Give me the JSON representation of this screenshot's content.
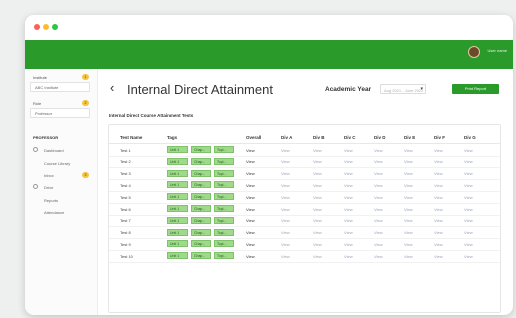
{
  "topbar": {
    "username": "User name"
  },
  "sidebar": {
    "institute_label": "Institute",
    "institute_value": "ABC Institute",
    "institute_badge": "1",
    "role_label": "Role",
    "role_value": "Professor",
    "role_badge": "2",
    "section_label": "PROFESSOR",
    "nav": {
      "dashboard": "Dashboard",
      "course_library": "Course Library",
      "inbox": "Inbox",
      "inbox_badge": "3",
      "drive": "Drive",
      "reports": "Reports",
      "attendance": "Attendance"
    }
  },
  "header": {
    "back_glyph": "‹",
    "title": "Internal Direct Attainment",
    "academic_year_label": "Academic Year",
    "academic_year_value": "Aug 2021 - June 2022",
    "dropdown_glyph": "▾",
    "print_label": "Print Report"
  },
  "table": {
    "section_title": "Internal Direct Course Attainment Tests",
    "headers": {
      "test_name": "Test Name",
      "tags": "Tags",
      "overall": "Overall",
      "div_a": "Div A",
      "div_b": "Div B",
      "div_c": "Div C",
      "div_d": "Div D",
      "div_e": "Div E",
      "div_f": "Div F",
      "div_g": "Div G"
    },
    "rows": [
      {
        "name": "Test 1",
        "tags": [
          "Unit 1",
          "Chap...",
          "Topi..."
        ],
        "overall": "View",
        "a": "View",
        "b": "View",
        "c": "View",
        "d": "View",
        "e": "View",
        "f": "View",
        "g": "View"
      },
      {
        "name": "Test 2",
        "tags": [
          "Unit 1",
          "Chap...",
          "Topi..."
        ],
        "overall": "View",
        "a": "View",
        "b": "View",
        "c": "View",
        "d": "View",
        "e": "View",
        "f": "View",
        "g": "View"
      },
      {
        "name": "Test 3",
        "tags": [
          "Unit 1",
          "Chap...",
          "Topi..."
        ],
        "overall": "View",
        "a": "View",
        "b": "View",
        "c": "View",
        "d": "View",
        "e": "View",
        "f": "View",
        "g": "View"
      },
      {
        "name": "Test 4",
        "tags": [
          "Unit 1",
          "Chap...",
          "Topi..."
        ],
        "overall": "View",
        "a": "View",
        "b": "View",
        "c": "View",
        "d": "View",
        "e": "View",
        "f": "View",
        "g": "View"
      },
      {
        "name": "Test 5",
        "tags": [
          "Unit 1",
          "Chap...",
          "Topi..."
        ],
        "overall": "View",
        "a": "View",
        "b": "View",
        "c": "View",
        "d": "View",
        "e": "View",
        "f": "View",
        "g": "View"
      },
      {
        "name": "Test 6",
        "tags": [
          "Unit 1",
          "Chap...",
          "Topi..."
        ],
        "overall": "View",
        "a": "View",
        "b": "View",
        "c": "View",
        "d": "View",
        "e": "View",
        "f": "View",
        "g": "View"
      },
      {
        "name": "Test 7",
        "tags": [
          "Unit 1",
          "Chap...",
          "Topi..."
        ],
        "overall": "View",
        "a": "View",
        "b": "View",
        "c": "View",
        "d": "View",
        "e": "View",
        "f": "View",
        "g": "View"
      },
      {
        "name": "Test 8",
        "tags": [
          "Unit 1",
          "Chap...",
          "Topi..."
        ],
        "overall": "View",
        "a": "View",
        "b": "View",
        "c": "View",
        "d": "View",
        "e": "View",
        "f": "View",
        "g": "View"
      },
      {
        "name": "Test 9",
        "tags": [
          "Unit 1",
          "Chap...",
          "Topi..."
        ],
        "overall": "View",
        "a": "View",
        "b": "View",
        "c": "View",
        "d": "View",
        "e": "View",
        "f": "View",
        "g": "View"
      },
      {
        "name": "Test 10",
        "tags": [
          "Unit 1",
          "Chap...",
          "Topi..."
        ],
        "overall": "View",
        "a": "View",
        "b": "View",
        "c": "View",
        "d": "View",
        "e": "View",
        "f": "View",
        "g": "View"
      }
    ]
  },
  "colors": {
    "brand_green": "#2a9a2a",
    "tag_green": "#9fd98a",
    "badge_yellow": "#f4c542",
    "traffic_red": "#ff5f57",
    "traffic_yellow": "#febc2e",
    "traffic_green": "#28c840"
  }
}
